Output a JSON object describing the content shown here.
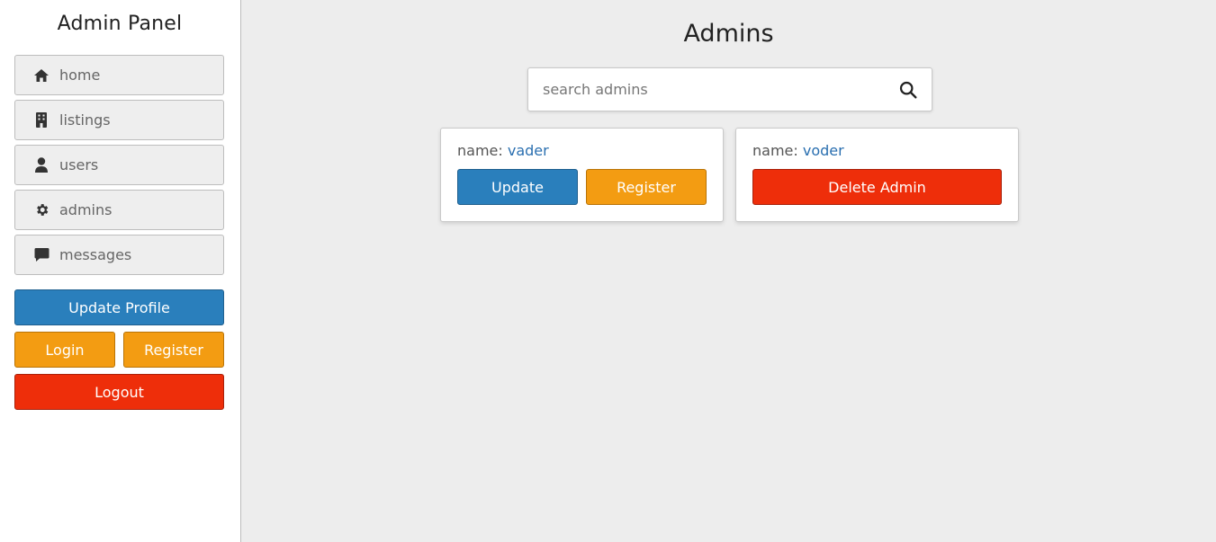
{
  "sidebar": {
    "title": "Admin Panel",
    "nav": [
      {
        "label": "home",
        "icon": "home-icon"
      },
      {
        "label": "listings",
        "icon": "building-icon"
      },
      {
        "label": "users",
        "icon": "user-icon"
      },
      {
        "label": "admins",
        "icon": "gear-icon"
      },
      {
        "label": "messages",
        "icon": "message-icon"
      }
    ],
    "update_profile": "Update Profile",
    "login": "Login",
    "register": "Register",
    "logout": "Logout"
  },
  "main": {
    "title": "Admins",
    "search": {
      "placeholder": "search admins",
      "value": ""
    },
    "cards": [
      {
        "name_label": "name:",
        "name": "vader",
        "update": "Update",
        "register": "Register"
      },
      {
        "name_label": "name:",
        "name": "voder",
        "delete": "Delete Admin"
      }
    ]
  },
  "colors": {
    "blue": "#2a7fbc",
    "orange": "#f39c12",
    "red": "#ee2e0a",
    "name_value": "#2a6fb0"
  }
}
